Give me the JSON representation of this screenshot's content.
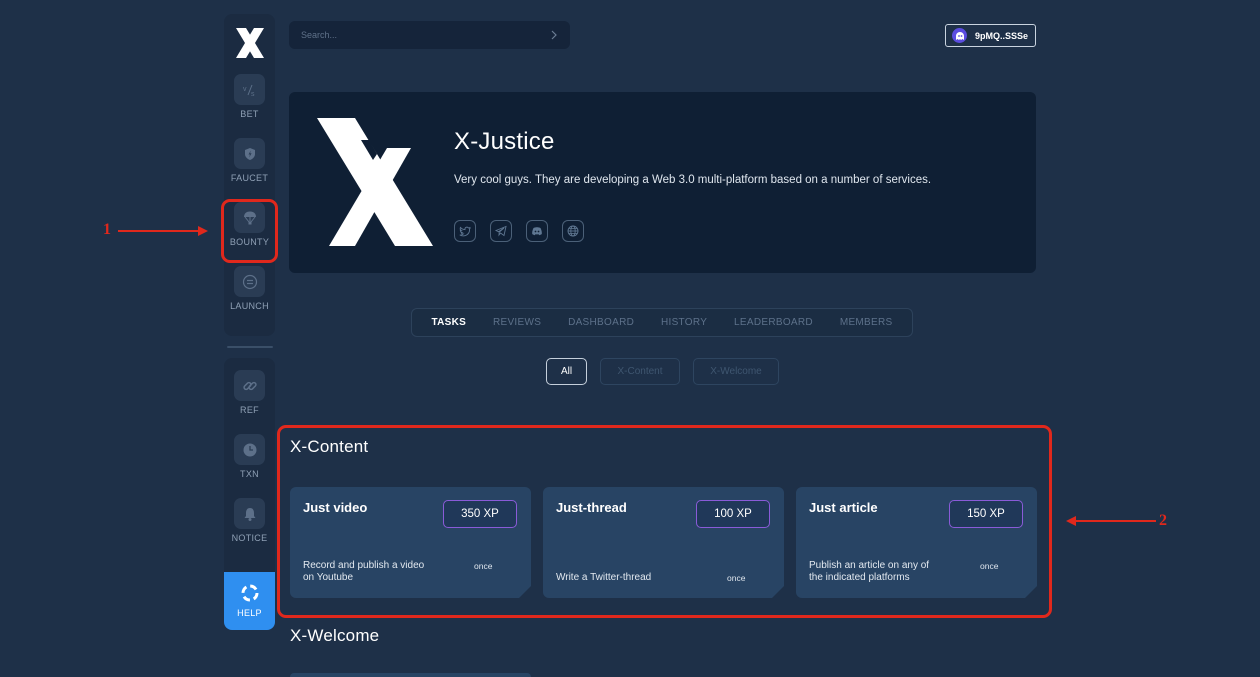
{
  "sidebar": {
    "items_top": [
      {
        "label": "BET",
        "icon": "bet-icon"
      },
      {
        "label": "FAUCET",
        "icon": "faucet-icon"
      },
      {
        "label": "BOUNTY",
        "icon": "parachute-icon"
      },
      {
        "label": "LAUNCH",
        "icon": "launch-icon"
      }
    ],
    "items_bottom": [
      {
        "label": "REF",
        "icon": "link-icon"
      },
      {
        "label": "TXN",
        "icon": "clock-icon"
      },
      {
        "label": "NOTICE",
        "icon": "bell-icon"
      }
    ],
    "help_label": "HELP"
  },
  "search": {
    "placeholder": "Search..."
  },
  "wallet": {
    "address": "9pMQ..SSSe"
  },
  "project": {
    "name": "X-Justice",
    "description": "Very cool guys. They are developing a Web 3.0 multi-platform based on a number of services.",
    "socials": [
      "twitter-icon",
      "telegram-icon",
      "discord-icon",
      "globe-icon"
    ]
  },
  "tabs": [
    "TASKS",
    "REVIEWS",
    "DASHBOARD",
    "HISTORY",
    "LEADERBOARD",
    "MEMBERS"
  ],
  "active_tab": "TASKS",
  "filters": [
    "All",
    "X-Content",
    "X-Welcome"
  ],
  "active_filter": "All",
  "sections": [
    {
      "title": "X-Content",
      "tasks": [
        {
          "title": "Just video",
          "xp": "350 XP",
          "description": "Record and publish a video on Youtube",
          "frequency": "once"
        },
        {
          "title": "Just-thread",
          "xp": "100 XP",
          "description": "Write a Twitter-thread",
          "frequency": "once"
        },
        {
          "title": "Just article",
          "xp": "150 XP",
          "description": "Publish an article on any of the indicated platforms",
          "frequency": "once"
        }
      ]
    },
    {
      "title": "X-Welcome"
    }
  ],
  "annotations": {
    "label1": "1",
    "label2": "2",
    "color": "#e0281c"
  },
  "colors": {
    "background": "#1e3048",
    "accent": "#2f8ff0",
    "xp_border": "#8a5bd8",
    "card": "#284464"
  }
}
